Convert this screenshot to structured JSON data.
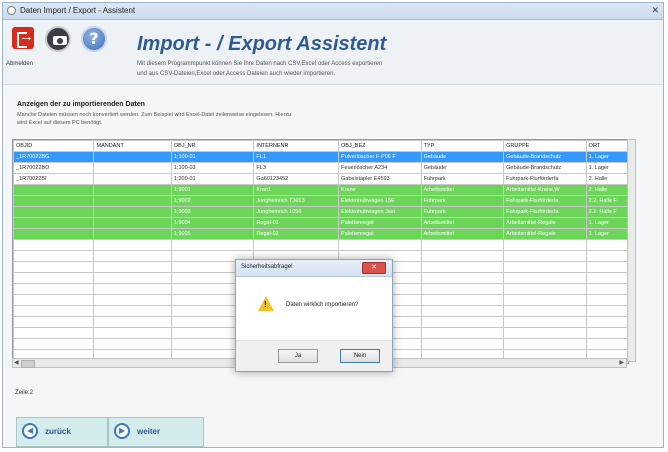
{
  "window": {
    "title": "Daten Import / Export - Assistent",
    "close_glyph": "✕"
  },
  "toolbar": {
    "exit_label": "Abmelden"
  },
  "header": {
    "title": "Import - / Export Assistent",
    "description_line1": "Mit diesem Programmpunkt können Sie Ihre Daten nach CSV,Excel oder Access exportieren",
    "description_line2": "und aus CSV-Dateien,Excel  oder Access Dateien auch wieder importieren."
  },
  "section": {
    "title": "Anzeigen der zu importierenden Daten",
    "hint_line1": "Manche Dateien müssen noch konvertiert werden. Zum Beispiel wird Excel-Datei zeilenweise eingelesen. Hierzu",
    "hint_line2": "wird Excel auf diesem PC benötigt."
  },
  "grid": {
    "columns": [
      "OBJID",
      "MANDANT",
      "OBJ_NR",
      "INTERNENR",
      "OBJ_BEZ",
      "TYP",
      "GRUPPE",
      "ORT"
    ],
    "rows": [
      {
        "style": "selected",
        "cells": [
          "_1R70022BG",
          "",
          "1;100-01",
          "FL1",
          "Pulverlöscher F-P06 F",
          "Gebäude",
          "Gebäude-Brandschutz",
          "1. Lager"
        ]
      },
      {
        "style": "normal",
        "cells": [
          "_1R70022BO",
          "",
          "1;100-03",
          "FL3",
          "Feuerlöscher A234",
          "Gebäude",
          "Gebäude-Brandschutz",
          "1. Lager"
        ]
      },
      {
        "style": "normal",
        "cells": [
          "_1R70022BI",
          "",
          "1;200-01",
          "Ga60123452",
          "Gabelstapler E4593",
          "Fuhrpark",
          "Fuhrpark-Flurförderfa",
          "2. Halle"
        ]
      },
      {
        "style": "green",
        "cells": [
          "",
          "",
          "1;9001",
          "Kran1",
          "Krane",
          "Arbeitsmittel",
          "Arbeitsmittel-Krane,W",
          "2. Halle"
        ]
      },
      {
        "style": "green",
        "cells": [
          "",
          "",
          "1;9002",
          "Jungheinrich T3013",
          "Elektrohubwagen 15E",
          "Fuhrpark",
          "Fuhrpark-Flurförderfa",
          "2.2. Halle F"
        ]
      },
      {
        "style": "green",
        "cells": [
          "",
          "",
          "1;9003",
          "Jungheinrich 1056",
          "Elektrohubwagen Jast",
          "Fuhrpark",
          "Fuhrpark-Flurförderfa",
          "2.2. Halle F"
        ]
      },
      {
        "style": "green",
        "cells": [
          "",
          "",
          "1;9004",
          "Regal-01",
          "Palettenregal",
          "Arbeitsmittel",
          "Arbeitsmittel-Regale",
          "1. Lager"
        ]
      },
      {
        "style": "green",
        "cells": [
          "",
          "",
          "1;9005",
          "Regal-02",
          "Palettenregal",
          "Arbeitsmittel",
          "Arbeitsmittel-Regale",
          "1. Lager"
        ]
      }
    ],
    "empty_rows": 11
  },
  "status": {
    "row_label": "Zeile:2"
  },
  "nav": {
    "back_label": "zurück",
    "forward_label": "weiter"
  },
  "dialog": {
    "title": "Sicherheitsabfrage!",
    "message": "Daten wirklich importieren?",
    "yes_label": "Ja",
    "no_label": "Nein"
  }
}
